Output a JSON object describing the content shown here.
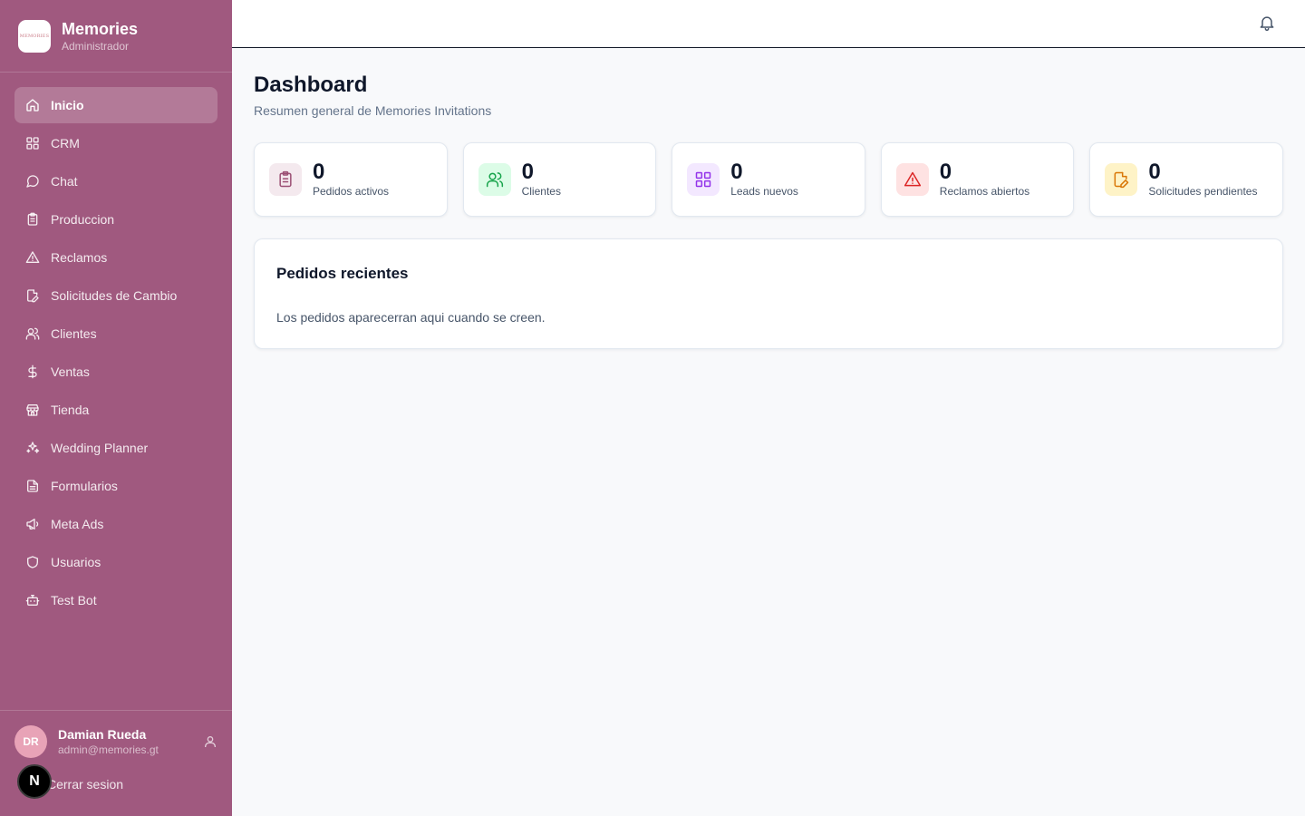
{
  "brand": {
    "name": "Memories",
    "role": "Administrador",
    "logo_text": "MEMORIES"
  },
  "sidebar": {
    "items": [
      {
        "label": "Inicio",
        "icon": "home-icon",
        "active": true
      },
      {
        "label": "CRM",
        "icon": "grid-icon",
        "active": false
      },
      {
        "label": "Chat",
        "icon": "message-circle-icon",
        "active": false
      },
      {
        "label": "Produccion",
        "icon": "clipboard-list-icon",
        "active": false
      },
      {
        "label": "Reclamos",
        "icon": "alert-triangle-icon",
        "active": false
      },
      {
        "label": "Solicitudes de Cambio",
        "icon": "file-edit-icon",
        "active": false
      },
      {
        "label": "Clientes",
        "icon": "users-icon",
        "active": false
      },
      {
        "label": "Ventas",
        "icon": "dollar-sign-icon",
        "active": false
      },
      {
        "label": "Tienda",
        "icon": "store-icon",
        "active": false
      },
      {
        "label": "Wedding Planner",
        "icon": "sparkles-icon",
        "active": false
      },
      {
        "label": "Formularios",
        "icon": "file-text-icon",
        "active": false
      },
      {
        "label": "Meta Ads",
        "icon": "megaphone-icon",
        "active": false
      },
      {
        "label": "Usuarios",
        "icon": "shield-icon",
        "active": false
      },
      {
        "label": "Test Bot",
        "icon": "bot-icon",
        "active": false
      }
    ]
  },
  "user": {
    "initials": "DR",
    "name": "Damian Rueda",
    "email": "admin@memories.gt",
    "logout_label": "Cerrar sesion"
  },
  "next_badge": "N",
  "page": {
    "title": "Dashboard",
    "subtitle": "Resumen general de Memories Invitations"
  },
  "stats": [
    {
      "value": "0",
      "label": "Pedidos activos",
      "icon": "clipboard-list-icon",
      "color": "#9b4f74",
      "bg": "#f4e9ee"
    },
    {
      "value": "0",
      "label": "Clientes",
      "icon": "users-icon",
      "color": "#16a34a",
      "bg": "#dcfce7"
    },
    {
      "value": "0",
      "label": "Leads nuevos",
      "icon": "grid-icon",
      "color": "#9333ea",
      "bg": "#f3e8ff"
    },
    {
      "value": "0",
      "label": "Reclamos abiertos",
      "icon": "alert-triangle-icon",
      "color": "#dc2626",
      "bg": "#fee2e2"
    },
    {
      "value": "0",
      "label": "Solicitudes pendientes",
      "icon": "file-edit-icon",
      "color": "#d97706",
      "bg": "#fef3c7"
    }
  ],
  "recent": {
    "title": "Pedidos recientes",
    "empty_text": "Los pedidos aparecerran aqui cuando se creen."
  },
  "colors": {
    "sidebar_bg": "#a0597f",
    "page_bg": "#f8f9fb",
    "text_primary": "#0f172a"
  }
}
